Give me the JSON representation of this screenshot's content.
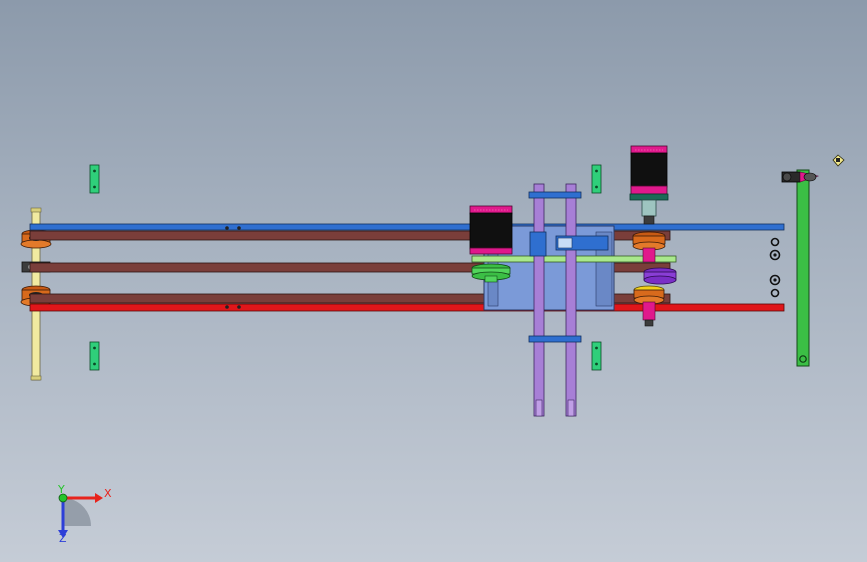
{
  "viewport": {
    "background_top": "#8c9aab",
    "background_bottom": "#c5ccd6"
  },
  "triad": {
    "x_label": "X",
    "y_label": "Y",
    "z_label": "Z",
    "x_color": "#e8231c",
    "y_color": "#25c42a",
    "z_color": "#2d3fd8"
  },
  "colors": {
    "rail_blue": "#2f6fd0",
    "rail_red": "#e0161a",
    "belt_brown": "#7a3e3a",
    "bracket_green": "#2fcf7a",
    "motor_magenta": "#e0198c",
    "motor_black": "#101010",
    "column_purple": "#a77fd6",
    "plate_blue": "#7b9ad8",
    "arm_green": "#3bbf45",
    "shaft_yellow": "#f1eaa0"
  }
}
